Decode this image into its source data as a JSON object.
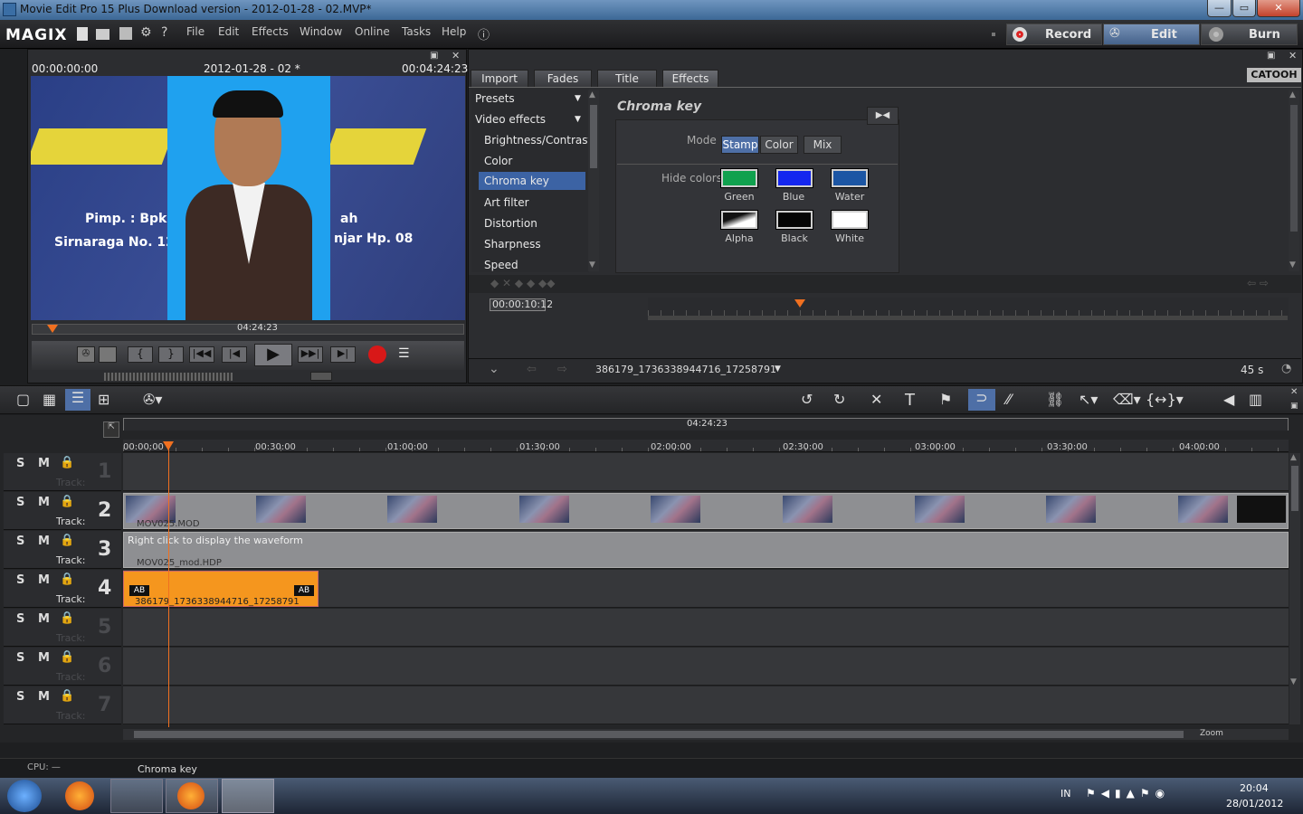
{
  "window": {
    "title": "Movie Edit Pro 15 Plus Download version - 2012-01-28 - 02.MVP*"
  },
  "app": {
    "logo": "MAGIX",
    "menu": [
      "File",
      "Edit",
      "Effects",
      "Window",
      "Online",
      "Tasks",
      "Help"
    ],
    "modes": {
      "record": "Record",
      "edit": "Edit",
      "burn": "Burn"
    }
  },
  "preview": {
    "time_start": "00:00:00:00",
    "title": "2012-01-28 - 02 *",
    "time_end": "00:04:24:23",
    "scrub_time": "04:24:23",
    "image_text": {
      "sign_left": "Pimp. : Bpk",
      "sign_left2": "Sirnaraga No. 12",
      "sign_right": "ah",
      "sign_right2": "njar Hp. 08"
    }
  },
  "media_panel": {
    "tabs": [
      "Import",
      "Fades",
      "Title",
      "Effects"
    ],
    "active_tab": "Effects",
    "brand": "CATOOH",
    "list": [
      "Presets",
      "Video effects",
      "Brightness/Contrast",
      "Color",
      "Chroma key",
      "Art filter",
      "Distortion",
      "Sharpness",
      "Speed"
    ],
    "selected": "Chroma key",
    "effect": {
      "title": "Chroma key",
      "mode_label": "Mode",
      "modes": [
        "Stamp",
        "Color",
        "Mix"
      ],
      "active_mode": "Stamp",
      "hide_label": "Hide colors",
      "colors": [
        {
          "name": "Green",
          "hex": "#10a14e"
        },
        {
          "name": "Blue",
          "hex": "#1426ef"
        },
        {
          "name": "Water",
          "hex": "#1c56a4"
        },
        {
          "name": "Alpha",
          "hex": "#888888"
        },
        {
          "name": "Black",
          "hex": "#050505"
        },
        {
          "name": "White",
          "hex": "#ffffff"
        }
      ]
    },
    "keyframe_time": "00:00:10:12",
    "file_name": "386179_1736338944716_17258791",
    "duration": "45 s"
  },
  "timeline": {
    "total": "04:24:23",
    "ticks": [
      "00:00:00",
      "00:30:00",
      "01:00:00",
      "01:30:00",
      "02:00:00",
      "02:30:00",
      "03:00:00",
      "03:30:00",
      "04:00:00"
    ],
    "tracks": [
      {
        "num": "1",
        "label": "Track:",
        "dim": true
      },
      {
        "num": "2",
        "label": "Track:",
        "dim": false,
        "clip": "MOV025.MOD"
      },
      {
        "num": "3",
        "label": "Track:",
        "dim": false,
        "clip": "MOV025_mod.HDP",
        "hint": "Right click to display the waveform"
      },
      {
        "num": "4",
        "label": "Track:",
        "dim": false,
        "clip": "386179_1736338944716_17258791",
        "ab": "AB"
      },
      {
        "num": "5",
        "label": "Track:",
        "dim": true
      },
      {
        "num": "6",
        "label": "Track:",
        "dim": true
      },
      {
        "num": "7",
        "label": "Track:",
        "dim": true
      }
    ],
    "zoom_label": "Zoom"
  },
  "status": {
    "cpu": "CPU: —",
    "effect": "Chroma key"
  },
  "taskbar": {
    "lang": "IN",
    "time": "20:04",
    "date": "28/01/2012"
  }
}
